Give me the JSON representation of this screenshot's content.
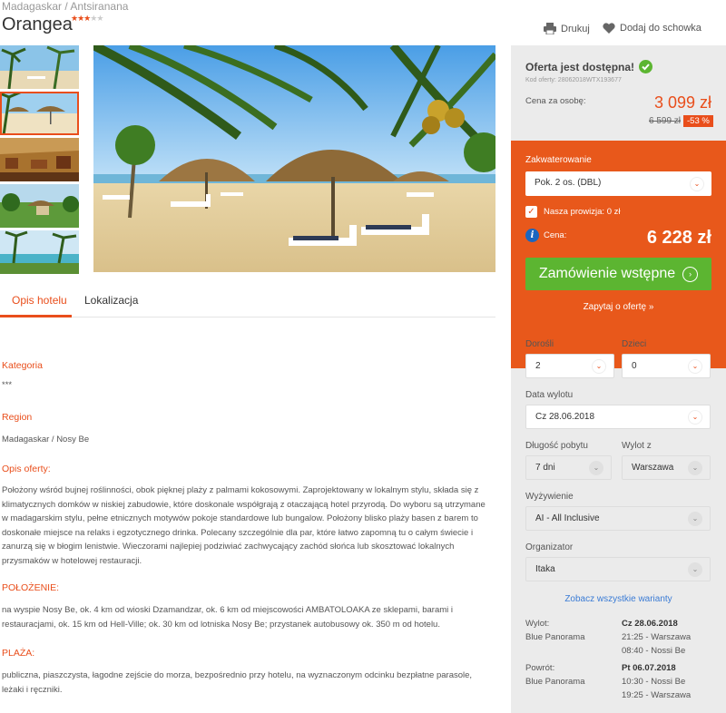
{
  "breadcrumb": "Madagaskar / Antsiranana",
  "hotel": {
    "name": "Orangea",
    "stars": 3
  },
  "actions": {
    "print": "Drukuj",
    "save": "Dodaj do schowka"
  },
  "tabs": [
    {
      "label": "Opis hotelu",
      "active": true
    },
    {
      "label": "Lokalizacja",
      "active": false
    }
  ],
  "sections": {
    "kategoria": {
      "title": "Kategoria",
      "text": "***"
    },
    "region": {
      "title": "Region",
      "text": "Madagaskar / Nosy Be"
    },
    "opis": {
      "title": "Opis oferty:",
      "text": "Położony wśród bujnej roślinności, obok pięknej plaży z palmami kokosowymi. Zaprojektowany w lokalnym stylu, składa się z klimatycznych domków w niskiej zabudowie, które doskonale współgrają z otaczającą hotel przyrodą. Do wyboru są utrzymane w madagarskim stylu, pełne etnicznych motywów pokoje standardowe lub bungalow. Położony blisko plaży basen z barem to doskonałe miejsce na relaks i egzotycznego drinka. Polecany szczególnie dla par, które łatwo zapomną tu o całym świecie i zanurzą się w błogim lenistwie. Wieczorami najlepiej podziwiać zachwycający zachód słońca lub skosztować lokalnych przysmaków w hotelowej restauracji."
    },
    "polozenie": {
      "title": "POŁOŻENIE:",
      "text": "na wyspie Nosy Be, ok. 4 km od wioski Dzamandzar, ok. 6 km od miejscowości AMBATOLOAKA ze sklepami, barami i restauracjami, ok. 15 km od Hell-Ville; ok. 30 km od lotniska Nosy Be; przystanek autobusowy ok. 350 m od hotelu."
    },
    "plaza": {
      "title": "PLAŻA:",
      "text": "publiczna, piaszczysta, łagodne zejście do morza, bezpośrednio przy hotelu, na wyznaczonym odcinku bezpłatne parasole, leżaki i ręczniki."
    }
  },
  "sidebar": {
    "availability": "Oferta jest dostępna!",
    "offer_code": "Kod oferty: 28062018WTX193677",
    "per_person_label": "Cena za osobę:",
    "per_person_price": "3 099 zł",
    "old_price": "6 599 zł",
    "discount": "-53 %",
    "accommodation_label": "Zakwaterowanie",
    "accommodation_value": "Pok. 2 os. (DBL)",
    "commission_label": "Nasza prowizja: 0 zł",
    "price_label": "Cena:",
    "price_total": "6 228 zł",
    "order_button": "Zamówienie wstępne",
    "ask_link": "Zapytaj o ofertę »",
    "adults_label": "Dorośli",
    "adults_value": "2",
    "children_label": "Dzieci",
    "children_value": "0",
    "departure_date_label": "Data wylotu",
    "departure_date_value": "Cz 28.06.2018",
    "stay_label": "Długość pobytu",
    "stay_value": "7 dni",
    "from_label": "Wylot z",
    "from_value": "Warszawa",
    "board_label": "Wyżywienie",
    "board_value": "AI - All Inclusive",
    "organizer_label": "Organizator",
    "organizer_value": "Itaka",
    "variants_link": "Zobacz wszystkie warianty",
    "outbound": {
      "label": "Wylot:",
      "carrier": "Blue Panorama",
      "date": "Cz 28.06.2018",
      "line1": "21:25 - Warszawa",
      "line2": "08:40 - Nossi Be"
    },
    "inbound": {
      "label": "Powrót:",
      "carrier": "Blue Panorama",
      "date": "Pt 06.07.2018",
      "line1": "10:30 - Nossi Be",
      "line2": "19:25 - Warszawa"
    }
  },
  "colors": {
    "accent": "#e94e1b",
    "sidebar_orange": "#e8581b",
    "green_button": "#5cb531",
    "link_blue": "#3a7bd5"
  }
}
